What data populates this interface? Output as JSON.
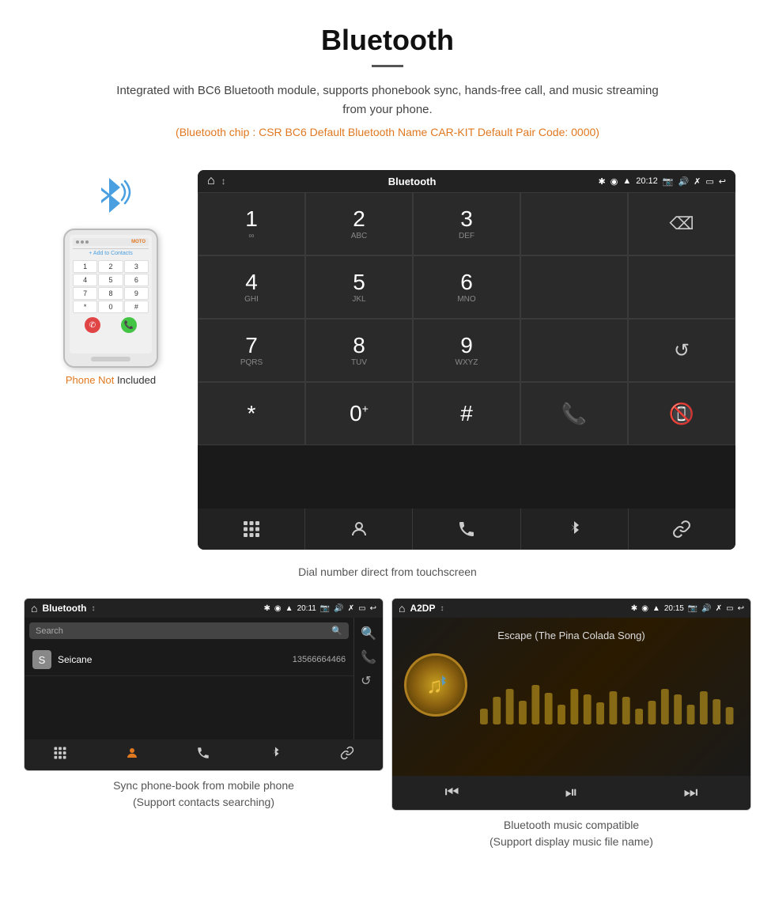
{
  "header": {
    "title": "Bluetooth",
    "description": "Integrated with BC6 Bluetooth module, supports phonebook sync, hands-free call, and music streaming from your phone.",
    "specs": "(Bluetooth chip : CSR BC6    Default Bluetooth Name CAR-KIT    Default Pair Code: 0000)"
  },
  "dial_screen": {
    "status_bar": {
      "home": "⌂",
      "title": "Bluetooth",
      "usb": "↕",
      "time": "20:12",
      "icons": [
        "✱",
        "◉",
        "▲",
        "📷",
        "🔊",
        "✗",
        "▭",
        "↩"
      ]
    },
    "keys": [
      {
        "num": "1",
        "letters": "∞"
      },
      {
        "num": "2",
        "letters": "ABC"
      },
      {
        "num": "3",
        "letters": "DEF"
      },
      {
        "num": "",
        "letters": ""
      },
      {
        "num": "⌫",
        "letters": ""
      },
      {
        "num": "4",
        "letters": "GHI"
      },
      {
        "num": "5",
        "letters": "JKL"
      },
      {
        "num": "6",
        "letters": "MNO"
      },
      {
        "num": "",
        "letters": ""
      },
      {
        "num": "",
        "letters": ""
      },
      {
        "num": "7",
        "letters": "PQRS"
      },
      {
        "num": "8",
        "letters": "TUV"
      },
      {
        "num": "9",
        "letters": "WXYZ"
      },
      {
        "num": "",
        "letters": ""
      },
      {
        "num": "↺",
        "letters": ""
      },
      {
        "num": "*",
        "letters": ""
      },
      {
        "num": "0",
        "letters": "+"
      },
      {
        "num": "#",
        "letters": ""
      },
      {
        "num": "📞",
        "letters": "call"
      },
      {
        "num": "📞",
        "letters": "end"
      }
    ],
    "bottom_nav": [
      "⠿",
      "👤",
      "📞",
      "✱",
      "🔗"
    ]
  },
  "dial_caption": "Dial number direct from touchscreen",
  "phone_not_included": "Phone Not Included",
  "phonebook_screen": {
    "status_bar_title": "Bluetooth",
    "usb": "↕",
    "time": "20:11",
    "search_placeholder": "Search",
    "contact": {
      "letter": "S",
      "name": "Seicane",
      "number": "13566664466"
    },
    "caption": "Sync phone-book from mobile phone\n(Support contacts searching)"
  },
  "music_screen": {
    "status_bar_title": "A2DP",
    "usb": "↕",
    "time": "20:15",
    "song_title": "Escape (The Pina Colada Song)",
    "caption": "Bluetooth music compatible\n(Support display music file name)",
    "eq_bars": [
      20,
      35,
      45,
      30,
      50,
      40,
      25,
      45,
      38,
      28,
      42,
      35,
      20,
      30,
      45,
      38,
      25,
      42,
      30,
      20
    ]
  }
}
